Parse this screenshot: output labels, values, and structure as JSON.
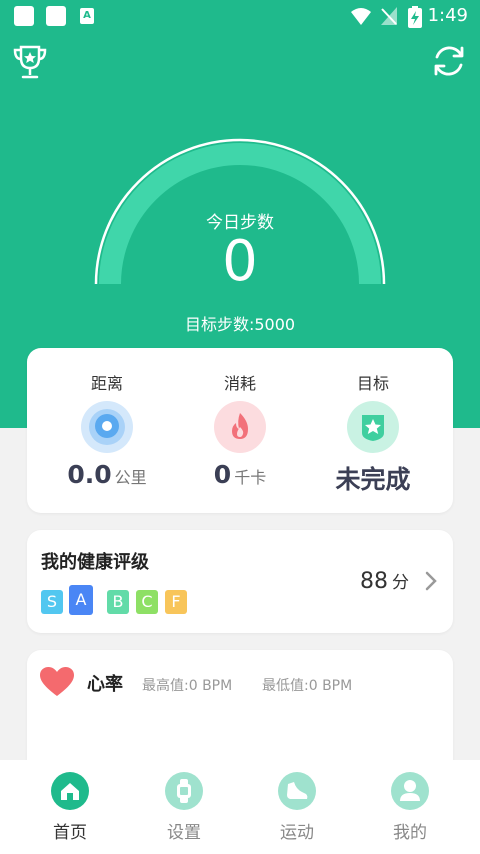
{
  "status_bar": {
    "time": "1:49",
    "a_icon_letter": "A"
  },
  "header": {
    "today_label": "今日步数",
    "today_steps": "0",
    "target_steps": "目标步数:5000",
    "progress_fraction": 0
  },
  "stats": [
    {
      "label": "距离",
      "value": "0.0",
      "unit": "公里",
      "icon": "location-pin-icon",
      "color": "#5aa9f0"
    },
    {
      "label": "消耗",
      "value": "0",
      "unit": "千卡",
      "icon": "flame-icon",
      "color": "#f2717a"
    },
    {
      "label": "目标",
      "value": "未完成",
      "unit": "",
      "icon": "star-badge-icon",
      "color": "#3fcf9f"
    }
  ],
  "health": {
    "title": "我的健康评级",
    "grades": [
      "S",
      "A",
      "B",
      "C",
      "F"
    ],
    "selected_grade": "A",
    "score": "88",
    "score_unit": "分"
  },
  "heart_rate": {
    "title": "心率",
    "max_text": "最高值:0  BPM",
    "min_text": "最低值:0  BPM"
  },
  "tabs": [
    {
      "label": "首页",
      "icon": "home-icon",
      "active": true
    },
    {
      "label": "设置",
      "icon": "watch-icon",
      "active": false
    },
    {
      "label": "运动",
      "icon": "shoe-icon",
      "active": false
    },
    {
      "label": "我的",
      "icon": "user-icon",
      "active": false
    }
  ],
  "colors": {
    "brand": "#1fba8c",
    "gauge_track": "#40d6aa",
    "grade_s": "#52c7f0",
    "grade_a": "#4a86f5",
    "grade_b": "#62dba8",
    "grade_c": "#8ee065",
    "grade_f": "#f8c55a",
    "tab_active": "#1fba8c",
    "tab_inactive": "#9fe2ce"
  }
}
